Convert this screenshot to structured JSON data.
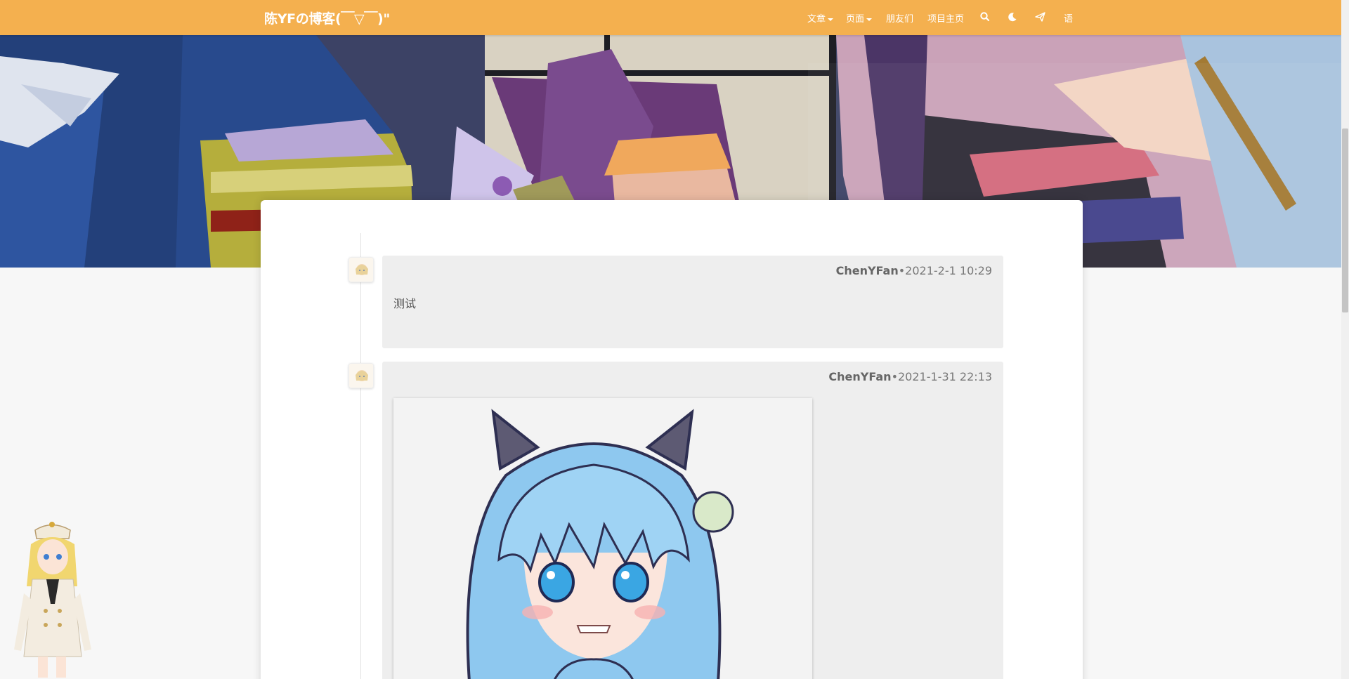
{
  "brand": {
    "title": "陈YFの博客(￣▽￣)\""
  },
  "nav": {
    "items": [
      {
        "label": "文章",
        "dropdown": true
      },
      {
        "label": "页面",
        "dropdown": true
      },
      {
        "label": "朋友们",
        "dropdown": false
      },
      {
        "label": "项目主页",
        "dropdown": false
      }
    ],
    "icons": [
      "search-icon",
      "moon-icon",
      "paper-plane-icon"
    ],
    "lang_label": "语"
  },
  "colors": {
    "navbar": "#f4b04f",
    "comment_bg": "#eeeeee",
    "card_bg": "#ffffff",
    "page_bg": "#f7f7f7"
  },
  "comments": [
    {
      "author": "ChenYFan",
      "separator": "•",
      "time": "2021-2-1 10:29",
      "text": "测试"
    },
    {
      "author": "ChenYFan",
      "separator": "•",
      "time": "2021-1-31 22:13",
      "text": ""
    }
  ]
}
